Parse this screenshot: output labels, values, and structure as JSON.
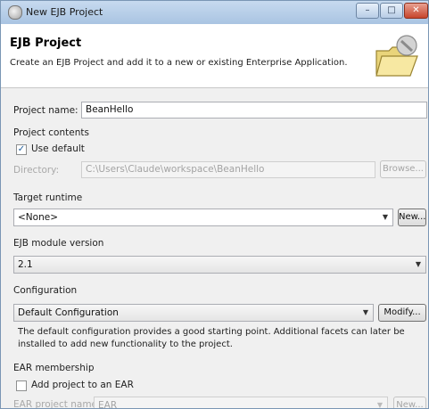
{
  "window": {
    "title": "New EJB Project"
  },
  "header": {
    "title": "EJB Project",
    "description": "Create an EJB Project and add it to a new or existing Enterprise Application."
  },
  "project_name": {
    "label": "Project name:",
    "value": "BeanHello"
  },
  "project_contents": {
    "heading": "Project contents",
    "use_default_label": "Use default",
    "use_default_checked": true,
    "directory_label": "Directory:",
    "directory_value": "C:\\Users\\Claude\\workspace\\BeanHello",
    "browse_label": "Browse..."
  },
  "target_runtime": {
    "heading": "Target runtime",
    "value": "<None>",
    "new_label": "New..."
  },
  "ejb_module_version": {
    "heading": "EJB module version",
    "value": "2.1"
  },
  "configuration": {
    "heading": "Configuration",
    "value": "Default Configuration",
    "modify_label": "Modify...",
    "description_line1": "The default configuration provides a good starting point. Additional facets can later be",
    "description_line2": "installed to add new functionality to the project."
  },
  "ear_membership": {
    "heading": "EAR membership",
    "add_label": "Add project to an EAR",
    "add_checked": false,
    "ear_name_label": "EAR project name:",
    "ear_name_value": "EAR",
    "new_label": "New..."
  }
}
